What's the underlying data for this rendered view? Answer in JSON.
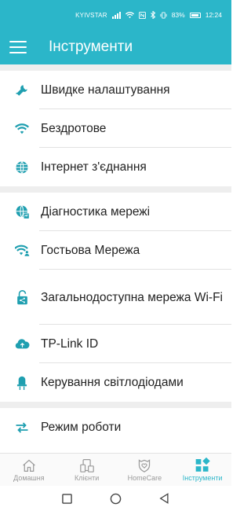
{
  "status_bar": {
    "carrier": "KYIVSTAR",
    "battery": "83%",
    "time": "12:24"
  },
  "app_bar": {
    "title": "Інструменти",
    "menu_icon": "hamburger-menu-icon"
  },
  "groups": [
    {
      "items": [
        {
          "label": "Швидке налаштування",
          "icon": "wrench-icon"
        },
        {
          "label": "Бездротове",
          "icon": "wifi-icon"
        },
        {
          "label": "Інтернет з'єднання",
          "icon": "globe-icon"
        }
      ]
    },
    {
      "items": [
        {
          "label": "Діагностика мережі",
          "icon": "globe-diagnostics-icon"
        },
        {
          "label": "Гостьова Мережа",
          "icon": "guest-wifi-icon"
        },
        {
          "label": "Загальнодоступна мережа Wi-Fi",
          "icon": "lock-share-icon"
        },
        {
          "label": "TP-Link ID",
          "icon": "cloud-upload-icon"
        },
        {
          "label": "Керування світлодіодами",
          "icon": "led-icon"
        }
      ]
    },
    {
      "items": [
        {
          "label": "Режим роботи",
          "icon": "switch-arrows-icon"
        }
      ]
    }
  ],
  "bottom_nav": [
    {
      "label": "Домашня",
      "icon": "home-icon",
      "active": false
    },
    {
      "label": "Клієнти",
      "icon": "devices-icon",
      "active": false
    },
    {
      "label": "HomeCare",
      "icon": "shield-heart-icon",
      "active": false
    },
    {
      "label": "Інструменти",
      "icon": "tools-grid-icon",
      "active": true
    }
  ],
  "colors": {
    "accent": "#2bb6c9",
    "icon": "#1f9fb0",
    "inactive": "#9a9a9a"
  }
}
